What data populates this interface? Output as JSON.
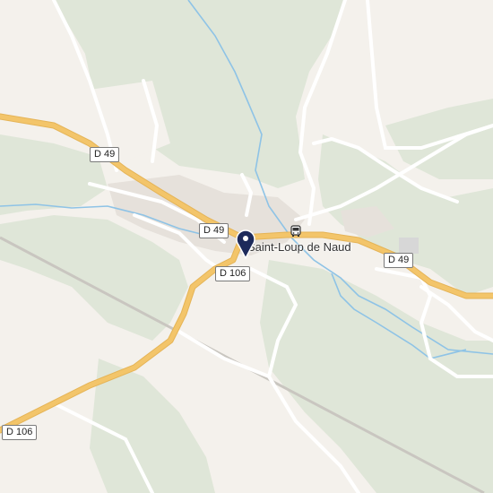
{
  "map": {
    "place_name": "Saint-Loup de Naud",
    "road_labels": {
      "d49_west": "D 49",
      "d49_center": "D 49",
      "d49_east": "D 49",
      "d106_center": "D 106",
      "d106_southwest": "D 106"
    },
    "icons": {
      "bus_stop": "bus-icon",
      "location_pin": "map-pin-icon"
    },
    "colors": {
      "background": "#f4f1ec",
      "forest": "#dfe6d8",
      "main_road": "#f3c56a",
      "minor_road": "#ffffff",
      "water": "#8ec3e6",
      "railway": "#c9c6c0",
      "pin": "#1d2a5b",
      "buildings": "#e6e1db"
    }
  }
}
